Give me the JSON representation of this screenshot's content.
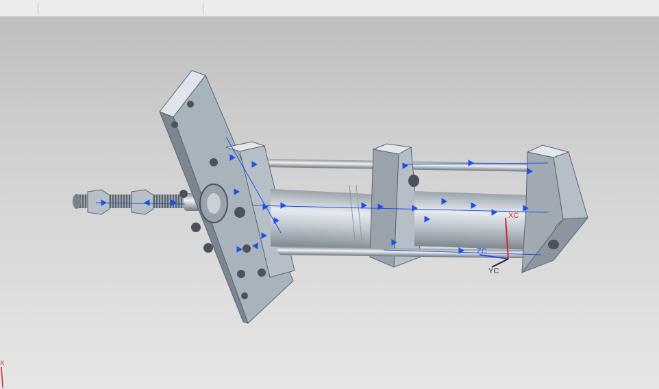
{
  "tabs": [
    {
      "label": ""
    },
    {
      "label": ""
    }
  ],
  "viewport": {
    "wcs_labels": {
      "xc": "XC",
      "yc": "YC",
      "zc": "ZC"
    },
    "absolute_axis_label": "X"
  },
  "colors": {
    "part_face": "#c4cdd7",
    "part_dark": "#8e99a4",
    "dimension_blue": "#1e50e6",
    "axis_red": "#e0202a",
    "background_top": "#bfbfbf",
    "background_bottom": "#e6e6e6"
  },
  "icons": {
    "wcs_triad": "csys-triad-icon",
    "absolute_csys": "absolute-csys-icon"
  }
}
